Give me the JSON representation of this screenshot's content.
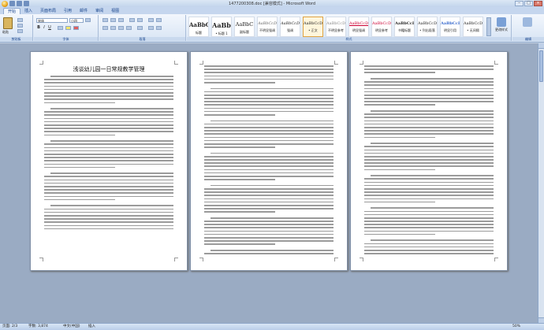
{
  "window": {
    "title": "1477200308.doc [兼容模式] - Microsoft Word",
    "min": "–",
    "max": "□",
    "close": "×"
  },
  "tabs": [
    "开始",
    "插入",
    "页面布局",
    "引用",
    "邮件",
    "审阅",
    "视图"
  ],
  "ribbon": {
    "clipboard": {
      "paste": "粘贴",
      "label": "剪贴板"
    },
    "font": {
      "name": "宋体",
      "size": "小四",
      "label": "字体",
      "bold": "B",
      "italic": "I",
      "underline": "U"
    },
    "paragraph": {
      "label": "段落"
    },
    "styles": {
      "label": "样式",
      "items": [
        {
          "preview": "AaBbC",
          "name": "标题"
        },
        {
          "preview": "AaBb",
          "name": "• 标题 1"
        },
        {
          "preview": "AaBbC",
          "name": "副标题"
        },
        {
          "preview": "AaBbCcD",
          "name": "不明显强调"
        },
        {
          "preview": "AaBbCcD",
          "name": "强调"
        },
        {
          "preview": "AaBbCcDd",
          "name": "• 正文"
        },
        {
          "preview": "AaBbCcD",
          "name": "不明显参考"
        },
        {
          "preview": "AaBbCcD",
          "name": "明显强调"
        },
        {
          "preview": "AaBbCcD",
          "name": "明显参考"
        },
        {
          "preview": "AaBbCcI",
          "name": "书籍标题"
        },
        {
          "preview": "AaBbCcD",
          "name": "• 列出段落"
        },
        {
          "preview": "AaBbCcD",
          "name": "明显引用"
        },
        {
          "preview": "AaBbCcD",
          "name": "• 无间隔"
        }
      ]
    },
    "change_styles": "更改样式",
    "editing": {
      "label": "编辑"
    }
  },
  "pages": [
    {
      "title": "浅谈幼儿园一日常规教学管理"
    }
  ],
  "status": {
    "page": "页面: 2/3",
    "words": "字数: 3,874",
    "lang": "中文(中国)",
    "mode": "插入",
    "zoom": "50%"
  }
}
